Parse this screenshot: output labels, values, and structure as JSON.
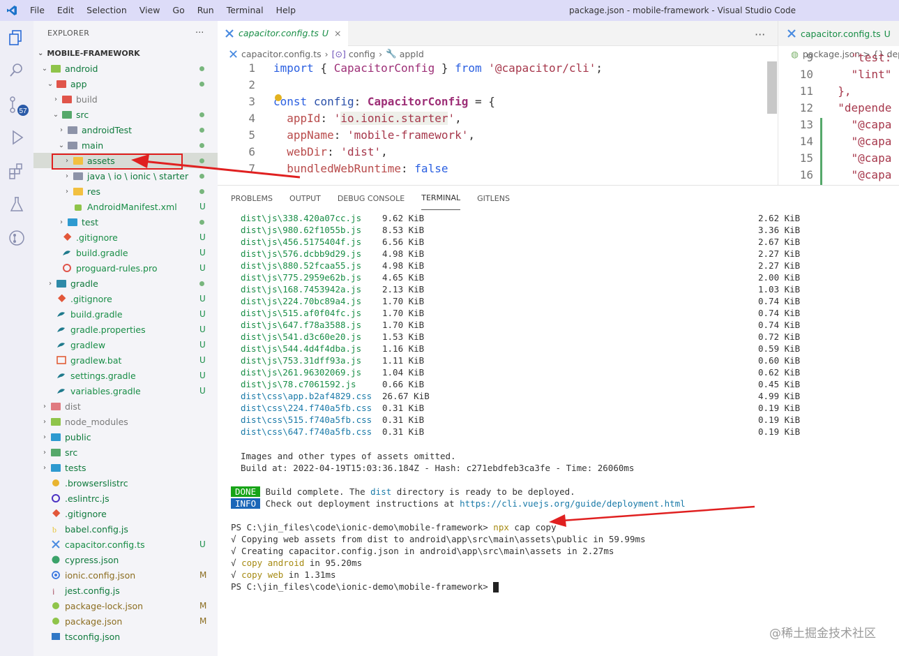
{
  "titlebar": {
    "menu": [
      "File",
      "Edit",
      "Selection",
      "View",
      "Go",
      "Run",
      "Terminal",
      "Help"
    ],
    "title": "package.json - mobile-framework - Visual Studio Code"
  },
  "activity": {
    "scm_badge": "57"
  },
  "explorer": {
    "title": "EXPLORER",
    "more": "···",
    "root": "MOBILE-FRAMEWORK",
    "items": [
      {
        "label": "android",
        "badge": ""
      },
      {
        "label": "app",
        "badge": ""
      },
      {
        "label": "build",
        "badge": ""
      },
      {
        "label": "src",
        "badge": ""
      },
      {
        "label": "androidTest",
        "badge": ""
      },
      {
        "label": "main",
        "badge": ""
      },
      {
        "label": "assets",
        "badge": ""
      },
      {
        "label": "java \\ io \\ ionic \\ starter",
        "badge": ""
      },
      {
        "label": "res",
        "badge": ""
      },
      {
        "label": "AndroidManifest.xml",
        "badge": "U"
      },
      {
        "label": "test",
        "badge": ""
      },
      {
        "label": ".gitignore",
        "badge": "U"
      },
      {
        "label": "build.gradle",
        "badge": "U"
      },
      {
        "label": "proguard-rules.pro",
        "badge": "U"
      },
      {
        "label": "gradle",
        "badge": ""
      },
      {
        "label": ".gitignore",
        "badge": "U"
      },
      {
        "label": "build.gradle",
        "badge": "U"
      },
      {
        "label": "gradle.properties",
        "badge": "U"
      },
      {
        "label": "gradlew",
        "badge": "U"
      },
      {
        "label": "gradlew.bat",
        "badge": "U"
      },
      {
        "label": "settings.gradle",
        "badge": "U"
      },
      {
        "label": "variables.gradle",
        "badge": "U"
      },
      {
        "label": "dist",
        "badge": ""
      },
      {
        "label": "node_modules",
        "badge": ""
      },
      {
        "label": "public",
        "badge": ""
      },
      {
        "label": "src",
        "badge": ""
      },
      {
        "label": "tests",
        "badge": ""
      },
      {
        "label": ".browserslistrc",
        "badge": ""
      },
      {
        "label": ".eslintrc.js",
        "badge": ""
      },
      {
        "label": ".gitignore",
        "badge": ""
      },
      {
        "label": "babel.config.js",
        "badge": ""
      },
      {
        "label": "capacitor.config.ts",
        "badge": "U"
      },
      {
        "label": "cypress.json",
        "badge": ""
      },
      {
        "label": "ionic.config.json",
        "badge": "M"
      },
      {
        "label": "jest.config.js",
        "badge": ""
      },
      {
        "label": "package-lock.json",
        "badge": "M"
      },
      {
        "label": "package.json",
        "badge": "M"
      },
      {
        "label": "tsconfig.json",
        "badge": ""
      }
    ]
  },
  "editor": {
    "tab": "capacitor.config.ts",
    "tab_badge": "U",
    "more": "···",
    "crumbs": [
      "capacitor.config.ts",
      "config",
      "appId"
    ],
    "lines": [
      {
        "n": "1",
        "t": "import { CapacitorConfig } from '@capacitor/cli';"
      },
      {
        "n": "2",
        "t": ""
      },
      {
        "n": "3",
        "t": "const config: CapacitorConfig = {"
      },
      {
        "n": "4",
        "t": "  appId: 'io.ionic.starter',"
      },
      {
        "n": "5",
        "t": "  appName: 'mobile-framework',"
      },
      {
        "n": "6",
        "t": "  webDir: 'dist',"
      },
      {
        "n": "7",
        "t": "  bundledWebRuntime: false"
      }
    ]
  },
  "right_editor": {
    "tab": "capacitor.config.ts",
    "tab_badge": "U",
    "crumb": "package.json > {} depe",
    "lines": [
      {
        "n": "9",
        "t": "    \"test:"
      },
      {
        "n": "10",
        "t": "    \"lint\""
      },
      {
        "n": "11",
        "t": "  },"
      },
      {
        "n": "12",
        "t": "  \"depende"
      },
      {
        "n": "13",
        "t": "    \"@capa"
      },
      {
        "n": "14",
        "t": "    \"@capa"
      },
      {
        "n": "15",
        "t": "    \"@capa"
      },
      {
        "n": "16",
        "t": "    \"@capa"
      }
    ]
  },
  "panel": {
    "tabs": [
      "PROBLEMS",
      "OUTPUT",
      "DEBUG CONSOLE",
      "TERMINAL",
      "GITLENS"
    ],
    "active_tab": "TERMINAL",
    "files": [
      {
        "f": "dist\\js\\338.420a07cc.js",
        "s": "9.62 KiB",
        "g": "2.62 KiB"
      },
      {
        "f": "dist\\js\\980.62f1055b.js",
        "s": "8.53 KiB",
        "g": "3.36 KiB"
      },
      {
        "f": "dist\\js\\456.5175404f.js",
        "s": "6.56 KiB",
        "g": "2.67 KiB"
      },
      {
        "f": "dist\\js\\576.dcbb9d29.js",
        "s": "4.98 KiB",
        "g": "2.27 KiB"
      },
      {
        "f": "dist\\js\\880.52fcaa55.js",
        "s": "4.98 KiB",
        "g": "2.27 KiB"
      },
      {
        "f": "dist\\js\\775.2959e62b.js",
        "s": "4.65 KiB",
        "g": "2.00 KiB"
      },
      {
        "f": "dist\\js\\168.7453942a.js",
        "s": "2.13 KiB",
        "g": "1.03 KiB"
      },
      {
        "f": "dist\\js\\224.70bc89a4.js",
        "s": "1.70 KiB",
        "g": "0.74 KiB"
      },
      {
        "f": "dist\\js\\515.af0f04fc.js",
        "s": "1.70 KiB",
        "g": "0.74 KiB"
      },
      {
        "f": "dist\\js\\647.f78a3588.js",
        "s": "1.70 KiB",
        "g": "0.74 KiB"
      },
      {
        "f": "dist\\js\\541.d3c60e20.js",
        "s": "1.53 KiB",
        "g": "0.72 KiB"
      },
      {
        "f": "dist\\js\\544.4d4f4dba.js",
        "s": "1.16 KiB",
        "g": "0.59 KiB"
      },
      {
        "f": "dist\\js\\753.31dff93a.js",
        "s": "1.11 KiB",
        "g": "0.60 KiB"
      },
      {
        "f": "dist\\js\\261.96302069.js",
        "s": "1.04 KiB",
        "g": "0.62 KiB"
      },
      {
        "f": "dist\\js\\78.c7061592.js",
        "s": "0.66 KiB",
        "g": "0.45 KiB"
      },
      {
        "f": "dist\\css\\app.b2af4829.css",
        "s": "26.67 KiB",
        "g": "4.99 KiB"
      },
      {
        "f": "dist\\css\\224.f740a5fb.css",
        "s": "0.31 KiB",
        "g": "0.19 KiB"
      },
      {
        "f": "dist\\css\\515.f740a5fb.css",
        "s": "0.31 KiB",
        "g": "0.19 KiB"
      },
      {
        "f": "dist\\css\\647.f740a5fb.css",
        "s": "0.31 KiB",
        "g": "0.19 KiB"
      }
    ],
    "omitted": "Images and other types of assets omitted.",
    "build_at": "Build at: 2022-04-19T15:03:36.184Z - Hash: c271ebdfeb3ca3fe - Time: 26060ms",
    "done_tag": "DONE",
    "done_pre": "Build complete. The ",
    "done_dir": "dist",
    "done_post": " directory is ready to be deployed.",
    "info_tag": "INFO",
    "info_pre": "Check out deployment instructions at ",
    "info_link": "https://cli.vuejs.org/guide/deployment.html",
    "prompt": "PS C:\\jin_files\\code\\ionic-demo\\mobile-framework> ",
    "cmd_npx": "npx",
    "cmd_rest": " cap copy",
    "step1": "√ Copying web assets from dist to android\\app\\src\\main\\assets\\public in 59.99ms",
    "step2": "√ Creating capacitor.config.json in android\\app\\src\\main\\assets in 2.27ms",
    "step3_pre": "√ ",
    "step3_cmd": "copy android",
    "step3_post": " in 95.20ms",
    "step4_pre": "√ ",
    "step4_cmd": "copy web",
    "step4_post": " in 1.31ms",
    "prompt2": "PS C:\\jin_files\\code\\ionic-demo\\mobile-framework> "
  },
  "watermark": "@稀土掘金技术社区"
}
